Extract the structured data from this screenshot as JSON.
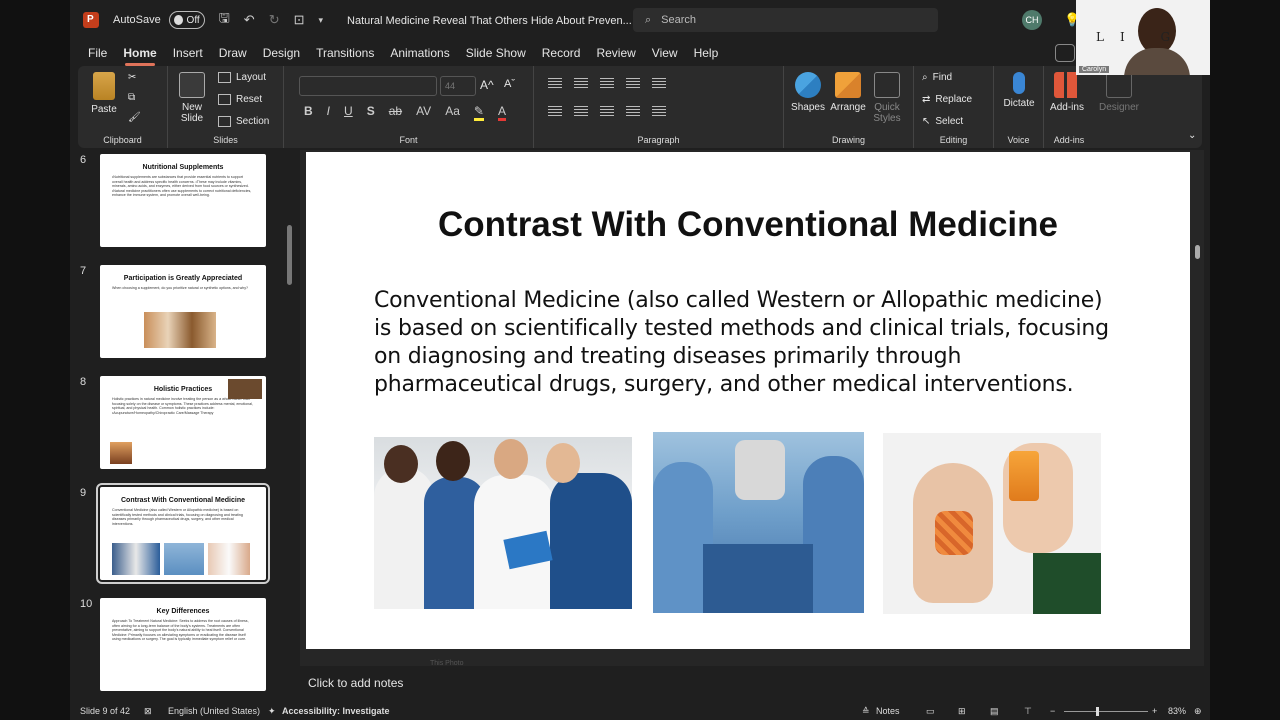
{
  "titlebar": {
    "autosave_label": "AutoSave",
    "autosave_state": "Off",
    "doc_title": "Natural Medicine Reveal That Others Hide About Preven... ⌄",
    "search_placeholder": "Search",
    "user_initials": "CH"
  },
  "menu": [
    "File",
    "Home",
    "Insert",
    "Draw",
    "Design",
    "Transitions",
    "Animations",
    "Slide Show",
    "Record",
    "Review",
    "View",
    "Help"
  ],
  "active_menu": "Home",
  "ribbon": {
    "clipboard": {
      "paste": "Paste",
      "label": "Clipboard"
    },
    "slides": {
      "new_slide": "New Slide",
      "layout": "Layout",
      "reset": "Reset",
      "section": "Section",
      "label": "Slides"
    },
    "font": {
      "size": "44",
      "label": "Font"
    },
    "paragraph": {
      "label": "Paragraph"
    },
    "drawing": {
      "shapes": "Shapes",
      "arrange": "Arrange",
      "quick_styles": "Quick Styles",
      "label": "Drawing"
    },
    "editing": {
      "find": "Find",
      "replace": "Replace",
      "select": "Select",
      "label": "Editing"
    },
    "voice": {
      "dictate": "Dictate",
      "label": "Voice"
    },
    "addins": {
      "addins": "Add-ins",
      "designer": "Designer",
      "label": "Add-ins"
    }
  },
  "thumbnails": [
    {
      "num": "6",
      "title": "Nutritional Supplements",
      "text": "•Nutritional supplements are substances that provide essential nutrients to support overall health and address specific health concerns.  •These may include vitamins, minerals, amino acids, and enzymes, either derived from food sources or synthesized.  •Natural medicine practitioners often use supplements to correct nutritional deficiencies, enhance the immune system, and promote overall well-being."
    },
    {
      "num": "7",
      "title": "Participation is Greatly Appreciated",
      "text": "When choosing a supplement, do you prioritize natural or synthetic options, and why?"
    },
    {
      "num": "8",
      "title": "Holistic Practices",
      "text": "Holistic practices in natural medicine involve treating the person as a whole rather than focusing solely on the disease or symptoms.  These practices address mental, emotional, spiritual, and physical health. Common holistic practices include:  •Acupuncture/Homeopathy/Chiropractic Care/Massage Therapy"
    },
    {
      "num": "9",
      "title": "Contrast With Conventional Medicine",
      "text": "Conventional Medicine (also called Western or Allopathic medicine) is based on scientifically tested methods and clinical trials, focusing on diagnosing and treating diseases primarily through pharmaceutical drugs, surgery, and other medical interventions."
    },
    {
      "num": "10",
      "title": "Key Differences",
      "text": "Approach To Treatment  Natural Medicine: Seeks to address the root causes of illness, often aiming for a long-term balance of the body's systems. Treatments are often preventative, aiming to support the body's natural ability to heal itself.  Conventional Medicine: Primarily focuses on alleviating symptoms or eradicating the disease itself using medications or surgery. The goal is typically immediate symptom relief or cure."
    }
  ],
  "slide": {
    "title": "Contrast With Conventional Medicine",
    "body": "Conventional Medicine (also called Western or Allopathic medicine) is based on scientifically tested methods and clinical trials, focusing on diagnosing and treating diseases primarily through pharmaceutical drugs, surgery, and other medical interventions.",
    "credit": "This Photo"
  },
  "notes_placeholder": "Click to add notes",
  "status": {
    "slide_count": "Slide 9 of 42",
    "language": "English (United States)",
    "accessibility": "Accessibility: Investigate",
    "notes": "Notes",
    "zoom": "83%"
  },
  "webcam": {
    "name": "Carolyn",
    "logo_text": "LI  G"
  }
}
